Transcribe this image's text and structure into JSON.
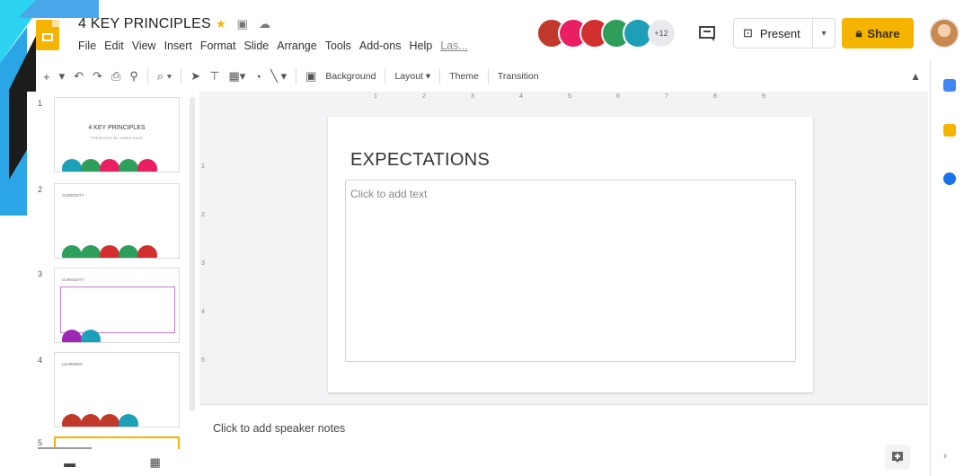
{
  "header": {
    "title": "4 KEY PRINCIPLES",
    "menu": [
      "File",
      "Edit",
      "View",
      "Insert",
      "Format",
      "Slide",
      "Arrange",
      "Tools",
      "Add-ons",
      "Help"
    ],
    "last_edit": "Las...",
    "collaborators_more": "+12",
    "present_label": "Present",
    "share_label": "Share"
  },
  "toolbar": {
    "background_label": "Background",
    "layout_label": "Layout",
    "theme_label": "Theme",
    "transition_label": "Transition"
  },
  "ruler": {
    "horizontal": [
      "1",
      "2",
      "3",
      "4",
      "5",
      "6",
      "7",
      "8",
      "9"
    ],
    "vertical": [
      "1",
      "2",
      "3",
      "4",
      "5"
    ]
  },
  "filmstrip": {
    "slides": [
      {
        "number": "1",
        "title": "4 KEY PRINCIPLES",
        "subtitle": "PRESENTED BY JAMES HANG"
      },
      {
        "number": "2",
        "heading": "CURIOSITY"
      },
      {
        "number": "3",
        "heading": "CURIOSITY"
      },
      {
        "number": "4",
        "heading": "LEARNING"
      },
      {
        "number": "5"
      }
    ]
  },
  "slide": {
    "title": "EXPECTATIONS",
    "body_placeholder": "Click to add text"
  },
  "notes_placeholder": "Click to add speaker notes",
  "colors": {
    "accent": "#f4b400",
    "collaborators": [
      "#c0392b",
      "#e91e63",
      "#d32f2f",
      "#2e9e5b",
      "#1e9fb8"
    ]
  }
}
